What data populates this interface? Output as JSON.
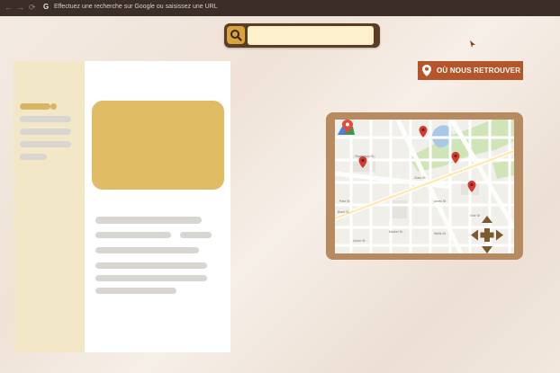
{
  "browser": {
    "back_icon": "arrow-left-icon",
    "forward_icon": "arrow-right-icon",
    "reload_icon": "reload-icon",
    "address_placeholder": "Effectuez une recherche sur Google ou saisissez une URL"
  },
  "search": {
    "icon": "search-icon",
    "value": "",
    "button_color": "#d8a33a"
  },
  "locate_button": {
    "label": "OÙ NOUS RETROUVER",
    "icon": "map-pin-icon",
    "color": "#b4562a"
  },
  "map": {
    "icon": "google-maps-icon",
    "markers": 4,
    "pan_control": "move-arrows-icon",
    "street_names": [
      "Thompson St",
      "Clark St",
      "Park St",
      "Ames St",
      "Bond St",
      "Market St",
      "Vine St",
      "Union St",
      "Wells St"
    ]
  },
  "colors": {
    "accent": "#b4562a",
    "sidebar": "#f2e8c8",
    "card": "#e0bd64",
    "map_frame": "#b88a60"
  }
}
